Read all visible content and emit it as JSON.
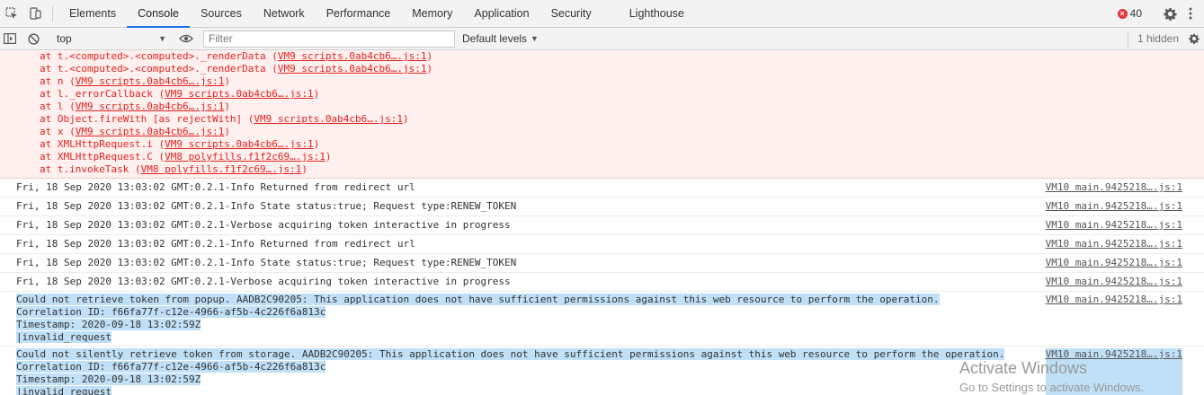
{
  "tabs": [
    {
      "label": "Elements",
      "active": false
    },
    {
      "label": "Console",
      "active": true
    },
    {
      "label": "Sources",
      "active": false
    },
    {
      "label": "Network",
      "active": false
    },
    {
      "label": "Performance",
      "active": false
    },
    {
      "label": "Memory",
      "active": false
    },
    {
      "label": "Application",
      "active": false
    },
    {
      "label": "Security",
      "active": false
    },
    {
      "label": "Lighthouse",
      "active": false
    }
  ],
  "error_count": "40",
  "toolbar": {
    "context": "top",
    "filter_placeholder": "Filter",
    "levels": "Default levels",
    "hidden": "1 hidden"
  },
  "stack": [
    {
      "prefix": "at t.<computed>.<computed>._renderData (",
      "link": "VM9 scripts.0ab4cb6….js:1",
      "suffix": ")"
    },
    {
      "prefix": "at t.<computed>.<computed>._renderData (",
      "link": "VM9 scripts.0ab4cb6….js:1",
      "suffix": ")"
    },
    {
      "prefix": "at n (",
      "link": "VM9 scripts.0ab4cb6….js:1",
      "suffix": ")"
    },
    {
      "prefix": "at l._errorCallback (",
      "link": "VM9 scripts.0ab4cb6….js:1",
      "suffix": ")"
    },
    {
      "prefix": "at l (",
      "link": "VM9 scripts.0ab4cb6….js:1",
      "suffix": ")"
    },
    {
      "prefix": "at Object.fireWith [as rejectWith] (",
      "link": "VM9 scripts.0ab4cb6….js:1",
      "suffix": ")"
    },
    {
      "prefix": "at x (",
      "link": "VM9 scripts.0ab4cb6….js:1",
      "suffix": ")"
    },
    {
      "prefix": "at XMLHttpRequest.i (",
      "link": "VM9 scripts.0ab4cb6….js:1",
      "suffix": ")"
    },
    {
      "prefix": "at XMLHttpRequest.C (",
      "link": "VM8 polyfills.f1f2c69….js:1",
      "suffix": ")"
    },
    {
      "prefix": "at t.invokeTask (",
      "link": "VM8 polyfills.f1f2c69….js:1",
      "suffix": ")"
    }
  ],
  "messages": [
    {
      "text": "Fri, 18 Sep 2020 13:03:02 GMT:0.2.1-Info Returned from redirect url",
      "source": "VM10 main.9425218….js:1"
    },
    {
      "text": "Fri, 18 Sep 2020 13:03:02 GMT:0.2.1-Info State status:true; Request type:RENEW_TOKEN",
      "source": "VM10 main.9425218….js:1"
    },
    {
      "text": "Fri, 18 Sep 2020 13:03:02 GMT:0.2.1-Verbose acquiring token interactive in progress",
      "source": "VM10 main.9425218….js:1"
    },
    {
      "text": "Fri, 18 Sep 2020 13:03:02 GMT:0.2.1-Info Returned from redirect url",
      "source": "VM10 main.9425218….js:1"
    },
    {
      "text": "Fri, 18 Sep 2020 13:03:02 GMT:0.2.1-Info State status:true; Request type:RENEW_TOKEN",
      "source": "VM10 main.9425218….js:1"
    },
    {
      "text": "Fri, 18 Sep 2020 13:03:02 GMT:0.2.1-Verbose acquiring token interactive in progress",
      "source": "VM10 main.9425218….js:1"
    }
  ],
  "multi_messages": [
    {
      "lines": [
        "Could not retrieve token from popup. AADB2C90205: This application does not have sufficient permissions against this web resource to perform the operation.",
        "Correlation ID: f66fa77f-c12e-4966-af5b-4c226f6a813c",
        "Timestamp: 2020-09-18 13:02:59Z",
        "|invalid_request"
      ],
      "source": "VM10 main.9425218….js:1"
    },
    {
      "lines": [
        "Could not silently retrieve token from storage. AADB2C90205: This application does not have sufficient permissions against this web resource to perform the operation.",
        "Correlation ID: f66fa77f-c12e-4966-af5b-4c226f6a813c",
        "Timestamp: 2020-09-18 13:02:59Z",
        "|invalid_request"
      ],
      "source": "VM10 main.9425218….js:1"
    }
  ],
  "watermark": {
    "title": "Activate Windows",
    "subtitle": "Go to Settings to activate Windows."
  },
  "colors": {
    "accent": "#1a73e8",
    "error_bg": "#fff0f0",
    "error_text": "#e0231c",
    "selection": "#bfe0f6"
  }
}
